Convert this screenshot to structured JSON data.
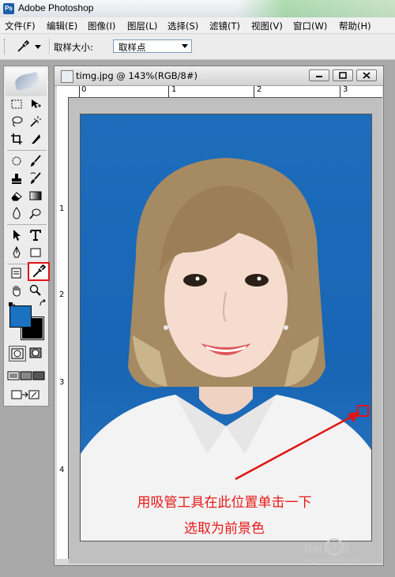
{
  "app": {
    "title": "Adobe Photoshop",
    "icon": "photoshop-app-icon"
  },
  "menu": [
    "文件(F)",
    "编辑(E)",
    "图像(I)",
    "图层(L)",
    "选择(S)",
    "滤镜(T)",
    "视图(V)",
    "窗口(W)",
    "帮助(H)"
  ],
  "options_bar": {
    "tool_icon": "eyedropper-icon",
    "sample_size_label": "取样大小:",
    "sample_size_value": "取样点"
  },
  "document": {
    "title": "timg.jpg @ 143%(RGB/8#)",
    "ruler_top": [
      "0",
      "1",
      "2",
      "3"
    ],
    "ruler_left": [
      "1",
      "2",
      "3",
      "4"
    ]
  },
  "colors": {
    "foreground": "#1a72c0",
    "background": "#000000",
    "highlight": "#e01414",
    "photo_background": "#1d6dbb"
  },
  "annotation": {
    "line1": "用吸管工具在此位置单击一下",
    "line2": "选取为前景色"
  },
  "watermark": {
    "text": "Bai 经验",
    "sub": "jingyan.baidu.com"
  }
}
